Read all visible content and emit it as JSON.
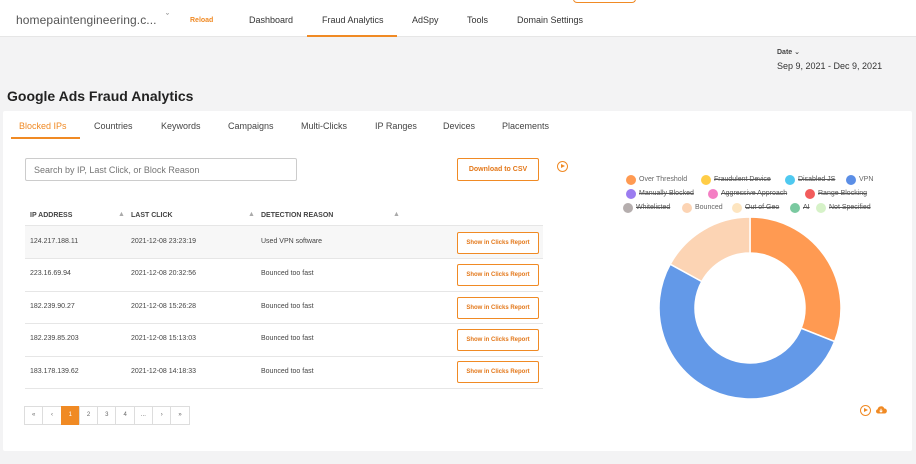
{
  "header": {
    "domain": "homepaintengineering.c...",
    "reload_label": "Reload",
    "tabs": [
      {
        "label": "Dashboard"
      },
      {
        "label": "Fraud Analytics"
      },
      {
        "label": "AdSpy"
      },
      {
        "label": "Tools"
      },
      {
        "label": "Domain Settings"
      }
    ],
    "active_tab": "Fraud Analytics"
  },
  "date": {
    "label": "Date",
    "value": "Sep 9, 2021 - Dec 9, 2021"
  },
  "page_title": "Google Ads Fraud Analytics",
  "subtabs": [
    {
      "label": "Blocked IPs"
    },
    {
      "label": "Countries"
    },
    {
      "label": "Keywords"
    },
    {
      "label": "Campaigns"
    },
    {
      "label": "Multi-Clicks"
    },
    {
      "label": "IP Ranges"
    },
    {
      "label": "Devices"
    },
    {
      "label": "Placements"
    }
  ],
  "search": {
    "placeholder": "Search by IP, Last Click, or Block Reason"
  },
  "csv_button": "Download to CSV",
  "table": {
    "columns": [
      "IP ADDRESS",
      "LAST CLICK",
      "DETECTION REASON"
    ],
    "rows": [
      {
        "ip": "124.217.188.11",
        "last_click": "2021-12-08 23:23:19",
        "reason": "Used VPN software",
        "action": "Show in Clicks Report"
      },
      {
        "ip": "223.16.69.94",
        "last_click": "2021-12-08 20:32:56",
        "reason": "Bounced too fast",
        "action": "Show in Clicks Report"
      },
      {
        "ip": "182.239.90.27",
        "last_click": "2021-12-08 15:26:28",
        "reason": "Bounced too fast",
        "action": "Show in Clicks Report"
      },
      {
        "ip": "182.239.85.203",
        "last_click": "2021-12-08 15:13:03",
        "reason": "Bounced too fast",
        "action": "Show in Clicks Report"
      },
      {
        "ip": "183.178.139.62",
        "last_click": "2021-12-08 14:18:33",
        "reason": "Bounced too fast",
        "action": "Show in Clicks Report"
      }
    ]
  },
  "pagination": {
    "items": [
      "«",
      "‹",
      "1",
      "2",
      "3",
      "4",
      "...",
      "›",
      "»"
    ],
    "current": "1"
  },
  "legend": [
    {
      "label": "Over Threshold",
      "color": "#ff9a52",
      "enabled": true
    },
    {
      "label": "Fraudulent Device",
      "color": "#ffcd47",
      "enabled": false
    },
    {
      "label": "Disabled JS",
      "color": "#4fc9f0",
      "enabled": false
    },
    {
      "label": "VPN",
      "color": "#5b8ee6",
      "enabled": true
    },
    {
      "label": "Manually Blocked",
      "color": "#9b7cf0",
      "enabled": false
    },
    {
      "label": "Aggressive Approach",
      "color": "#f47fc4",
      "enabled": false
    },
    {
      "label": "Range Blocking",
      "color": "#f25c5c",
      "enabled": false
    },
    {
      "label": "Whitelisted",
      "color": "#b5aeae",
      "enabled": false
    },
    {
      "label": "Bounced",
      "color": "#fcd4b4",
      "enabled": true
    },
    {
      "label": "Out of Geo",
      "color": "#fde5c0",
      "enabled": false
    },
    {
      "label": "AI",
      "color": "#7ac9a0",
      "enabled": false
    },
    {
      "label": "Not Specified",
      "color": "#d6f2c8",
      "enabled": false
    }
  ],
  "chart_data": {
    "type": "pie",
    "donut": true,
    "slices": [
      {
        "label": "Over Threshold",
        "value": 31,
        "color": "#ff9a52"
      },
      {
        "label": "VPN",
        "value": 52,
        "color": "#6399e8"
      },
      {
        "label": "Bounced",
        "value": 17,
        "color": "#fcd4b4"
      }
    ]
  }
}
